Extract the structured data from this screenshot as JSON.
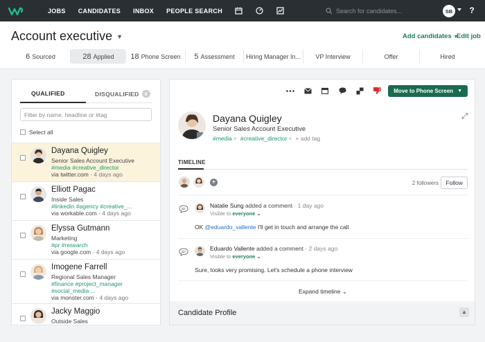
{
  "nav": {
    "links": [
      "JOBS",
      "CANDIDATES",
      "INBOX",
      "PEOPLE SEARCH"
    ],
    "search_placeholder": "Search for candidates...",
    "user_initials": "SB",
    "help": "?"
  },
  "header": {
    "job_title": "Account executive",
    "add_candidates": "Add candidates",
    "edit_job": "Edit job",
    "stages": [
      {
        "count": "6",
        "label": "Sourced"
      },
      {
        "count": "28",
        "label": "Applied"
      },
      {
        "count": "18",
        "label": "Phone Screen"
      },
      {
        "count": "5",
        "label": "Assessment"
      },
      {
        "count": "",
        "label": "Hiring Manager In..."
      },
      {
        "count": "",
        "label": "VP Interview"
      },
      {
        "count": "",
        "label": "Offer"
      },
      {
        "count": "",
        "label": "Hired"
      }
    ]
  },
  "list": {
    "tab_qualified": "QUALIFIED",
    "tab_disqualified": "DISQUALIFIED",
    "disqualified_count": "0",
    "filter_placeholder": "Filter by name, headline or #tag",
    "select_all": "Select all",
    "candidates": [
      {
        "name": "Dayana Quigley",
        "title": "Senior Sales Account Executive",
        "tags": "#media #creative_director",
        "via": "via twitter.com",
        "ago": "4 days ago"
      },
      {
        "name": "Elliott Pagac",
        "title": "Inside Sales",
        "tags": "#linkedin #agency #creative_...",
        "via": "via workable.com",
        "ago": "4 days ago"
      },
      {
        "name": "Elyssa Gutmann",
        "title": "Marketing",
        "tags": "#pr #research",
        "via": "via google.com",
        "ago": "4 days ago"
      },
      {
        "name": "Imogene Farrell",
        "title": "Regional Sales Manager",
        "tags": "#finance #project_manager",
        "tags2": "#social_media ...",
        "via": "via monster.com",
        "ago": "4 days ago"
      },
      {
        "name": "Jacky Maggio",
        "title": "Outside Sales"
      }
    ]
  },
  "profile": {
    "move_button": "Move to Phone Screen",
    "name": "Dayana Quigley",
    "title": "Senior Sales Account Executive",
    "tags": [
      "#media",
      "#creative_director"
    ],
    "add_tag": "+ add tag",
    "timeline_tab": "TIMELINE",
    "followers": "2 followers",
    "follow": "Follow",
    "comments": [
      {
        "author": "Natalie Sung",
        "action": "added a comment",
        "ago": "· 1 day ago",
        "visible_prefix": "Visible to",
        "visible_to": "everyone",
        "text_prefix": "OK ",
        "mention": "@eduardo_vallente",
        "text": " I'll get in touch and arrange the call"
      },
      {
        "author": "Eduardo Vallente",
        "action": "added a comment",
        "ago": "· 2 days ago",
        "visible_prefix": "Visible to",
        "visible_to": "everyone",
        "text": "Sure, looks very promising. Let's schedule a phone interview"
      }
    ],
    "expand_timeline": "Expand timeline",
    "candidate_profile": "Candidate Profile"
  },
  "colors": {
    "nav_bg": "#2a2f33",
    "accent_green": "#1a6b4f",
    "tag_green": "#1d9966",
    "selected_row": "#fcf3dc",
    "mention_blue": "#1f6fc9"
  }
}
